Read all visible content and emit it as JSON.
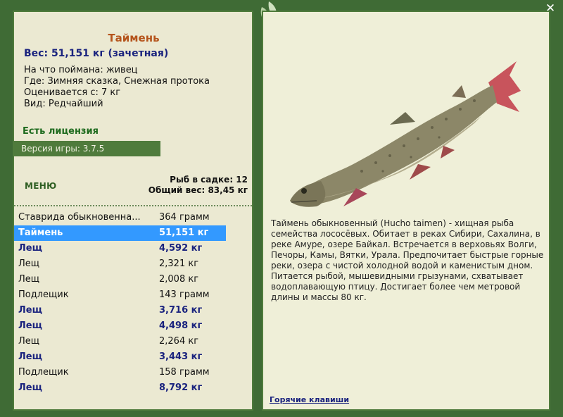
{
  "fish": {
    "name": "Таймень",
    "weight_line": "Вес: 51,151 кг (зачетная)",
    "caught_on": "На что поймана: живец",
    "location": "Где: Зимняя сказка, Снежная протока",
    "value": "Оценивается с: 7 кг",
    "kind": "Вид: Редчайший",
    "description": "Таймень обыкновенный (Hucho taimen) - хищная рыба семейства лососёвых. Обитает в реках Сибири, Сахалина, в реке Амуре, озере Байкал. Встречается в верховьях Волги, Печоры, Камы, Вятки, Урала. Предпочитает быстрые горные реки, озера с чистой холодной водой и каменистым дном. Питается рыбой, мышевидными грызунами, схватывает водоплавающую птицу. Достигает более чем метровой длины и массы 80 кг."
  },
  "license": "Есть лицензия",
  "version": "Версия игры: 3.7.5",
  "menu_label": "МЕНЮ",
  "keep_count": "Рыб в садке: 12",
  "total_weight": "Общий вес: 83,45 кг",
  "catches": [
    {
      "name": "Ставрида обыкновенна...",
      "weight": "364 грамм",
      "style": "normal"
    },
    {
      "name": "Таймень",
      "weight": "51,151 кг",
      "style": "selected"
    },
    {
      "name": "Лещ",
      "weight": "4,592 кг",
      "style": "bold"
    },
    {
      "name": "Лещ",
      "weight": "2,321 кг",
      "style": "normal"
    },
    {
      "name": "Лещ",
      "weight": "2,008 кг",
      "style": "normal"
    },
    {
      "name": "Подлещик",
      "weight": "143 грамм",
      "style": "normal"
    },
    {
      "name": "Лещ",
      "weight": "3,716 кг",
      "style": "bold"
    },
    {
      "name": "Лещ",
      "weight": "4,498 кг",
      "style": "bold"
    },
    {
      "name": "Лещ",
      "weight": "2,264 кг",
      "style": "normal"
    },
    {
      "name": "Лещ",
      "weight": "3,443 кг",
      "style": "bold"
    },
    {
      "name": "Подлещик",
      "weight": "158 грамм",
      "style": "normal"
    },
    {
      "name": "Лещ",
      "weight": "8,792 кг",
      "style": "bold"
    }
  ],
  "hotkeys_link": "Горячие клавиши",
  "close_symbol": "✕",
  "colors": {
    "frame": "#3f6b35",
    "panel": "#ebe9d2",
    "title": "#b5541c",
    "accent": "#1a237e",
    "selection": "#3399ff"
  }
}
